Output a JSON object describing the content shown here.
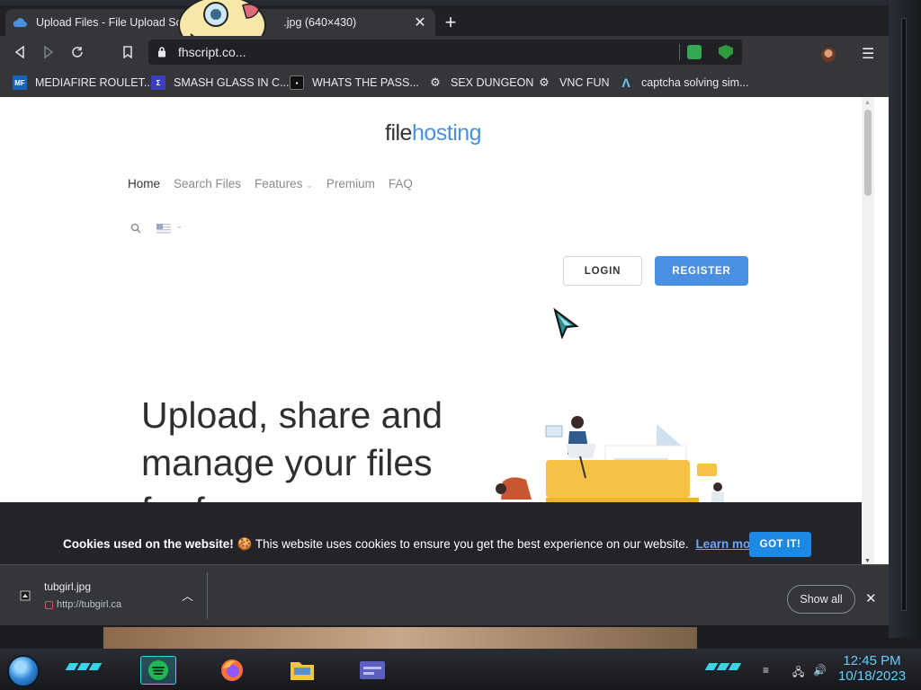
{
  "browser": {
    "tab": {
      "title": "Upload Files - File Upload Script",
      "title_suffix": ".jpg (640×430)"
    },
    "url": "fhscript.co...",
    "bookmarks": [
      {
        "label": "MEDIAFIRE ROULET...",
        "icon": "mediafire-icon",
        "icon_text": "MF"
      },
      {
        "label": "SMASH GLASS IN C...",
        "icon": "glass-icon"
      },
      {
        "label": "WHATS THE PASS...",
        "icon": "lock-bookmark-icon"
      },
      {
        "label": "SEX DUNGEON",
        "icon": "dungeon-icon"
      },
      {
        "label": "VNC FUN",
        "icon": "vnc-icon"
      },
      {
        "label": "captcha solving sim...",
        "icon": "captcha-icon"
      }
    ]
  },
  "page": {
    "logo": {
      "part1": "file",
      "part2": "hosting"
    },
    "nav": [
      {
        "label": "Home"
      },
      {
        "label": "Search Files"
      },
      {
        "label": "Features"
      },
      {
        "label": "Premium"
      },
      {
        "label": "FAQ"
      }
    ],
    "login_label": "LOGIN",
    "register_label": "REGISTER",
    "hero_line1": "Upload, share and",
    "hero_line2": "manage your files",
    "hero_line3": "for free"
  },
  "cookie": {
    "title": "Cookies used on the website!",
    "emoji": "🍪",
    "message": "This website uses cookies to ensure you get the best experience on our website.",
    "learn_more": "Learn more",
    "accept": "GOT IT!"
  },
  "downloads": {
    "file_name": "tubgirl.jpg",
    "source": "http://tubgirl.ca",
    "show_all": "Show all"
  },
  "taskbar": {
    "time": "12:45 PM",
    "date": "10/18/2023"
  },
  "colors": {
    "brand_blue": "#4a90e2",
    "cookie_button": "#1e88e5",
    "clock": "#5fd0ff"
  }
}
